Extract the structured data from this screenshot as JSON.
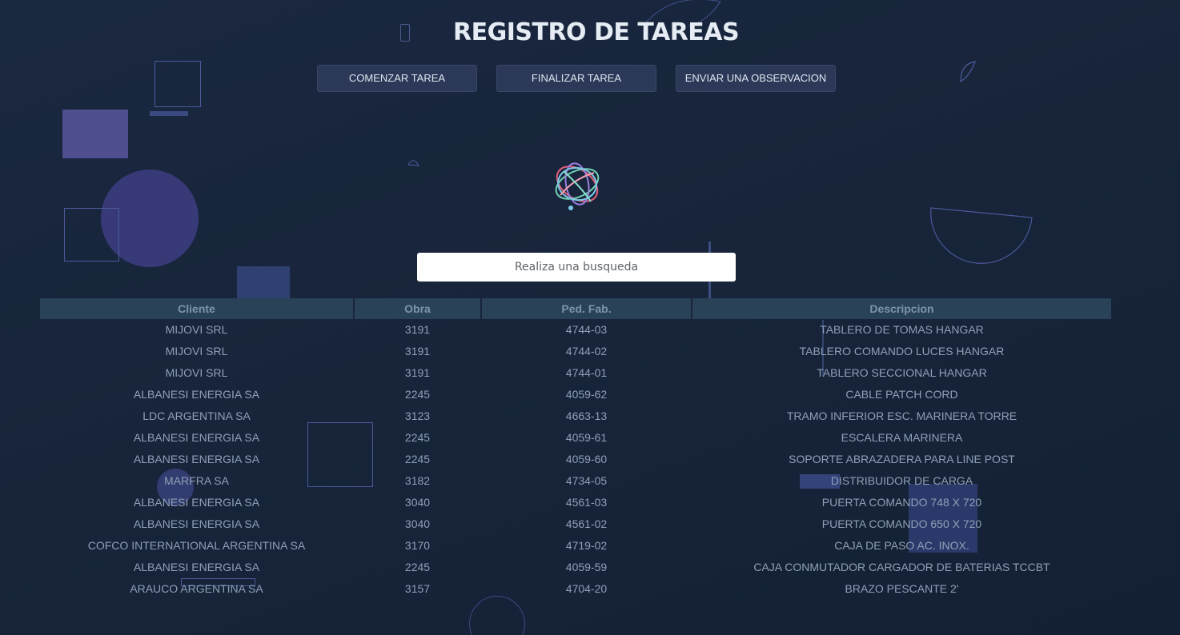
{
  "header": {
    "title": "REGISTRO DE TAREAS"
  },
  "actions": {
    "start_label": "COMENZAR TAREA",
    "finish_label": "FINALIZAR TAREA",
    "observation_label": "ENVIAR UNA OBSERVACION"
  },
  "search": {
    "placeholder": "Realiza una busqueda"
  },
  "table": {
    "columns": [
      "Cliente",
      "Obra",
      "Ped. Fab.",
      "Descripcion"
    ],
    "rows": [
      [
        "MIJOVI SRL",
        "3191",
        "4744-03",
        "TABLERO DE TOMAS HANGAR"
      ],
      [
        "MIJOVI SRL",
        "3191",
        "4744-02",
        "TABLERO COMANDO LUCES HANGAR"
      ],
      [
        "MIJOVI SRL",
        "3191",
        "4744-01",
        "TABLERO SECCIONAL HANGAR"
      ],
      [
        "ALBANESI ENERGIA SA",
        "2245",
        "4059-62",
        "CABLE PATCH CORD"
      ],
      [
        "LDC ARGENTINA SA",
        "3123",
        "4663-13",
        "TRAMO INFERIOR ESC. MARINERA TORRE"
      ],
      [
        "ALBANESI ENERGIA SA",
        "2245",
        "4059-61",
        "ESCALERA MARINERA"
      ],
      [
        "ALBANESI ENERGIA SA",
        "2245",
        "4059-60",
        "SOPORTE ABRAZADERA PARA LINE POST"
      ],
      [
        "MARFRA SA",
        "3182",
        "4734-05",
        "DISTRIBUIDOR DE CARGA"
      ],
      [
        "ALBANESI ENERGIA SA",
        "3040",
        "4561-03",
        "PUERTA COMANDO 748 X 720"
      ],
      [
        "ALBANESI ENERGIA SA",
        "3040",
        "4561-02",
        "PUERTA COMANDO 650 X 720"
      ],
      [
        "COFCO INTERNATIONAL ARGENTINA SA",
        "3170",
        "4719-02",
        "CAJA DE PASO AC. INOX."
      ],
      [
        "ALBANESI ENERGIA SA",
        "2245",
        "4059-59",
        "CAJA CONMUTADOR CARGADOR DE BATERIAS TCCBT"
      ],
      [
        "ARAUCO ARGENTINA SA",
        "3157",
        "4704-20",
        "BRAZO PESCANTE 2'"
      ]
    ]
  },
  "colors": {
    "background": "#17243a",
    "button": "#2b3857",
    "table_header": "#2a4258",
    "title": "#e6ecf3",
    "text": "#8fa0b6"
  }
}
